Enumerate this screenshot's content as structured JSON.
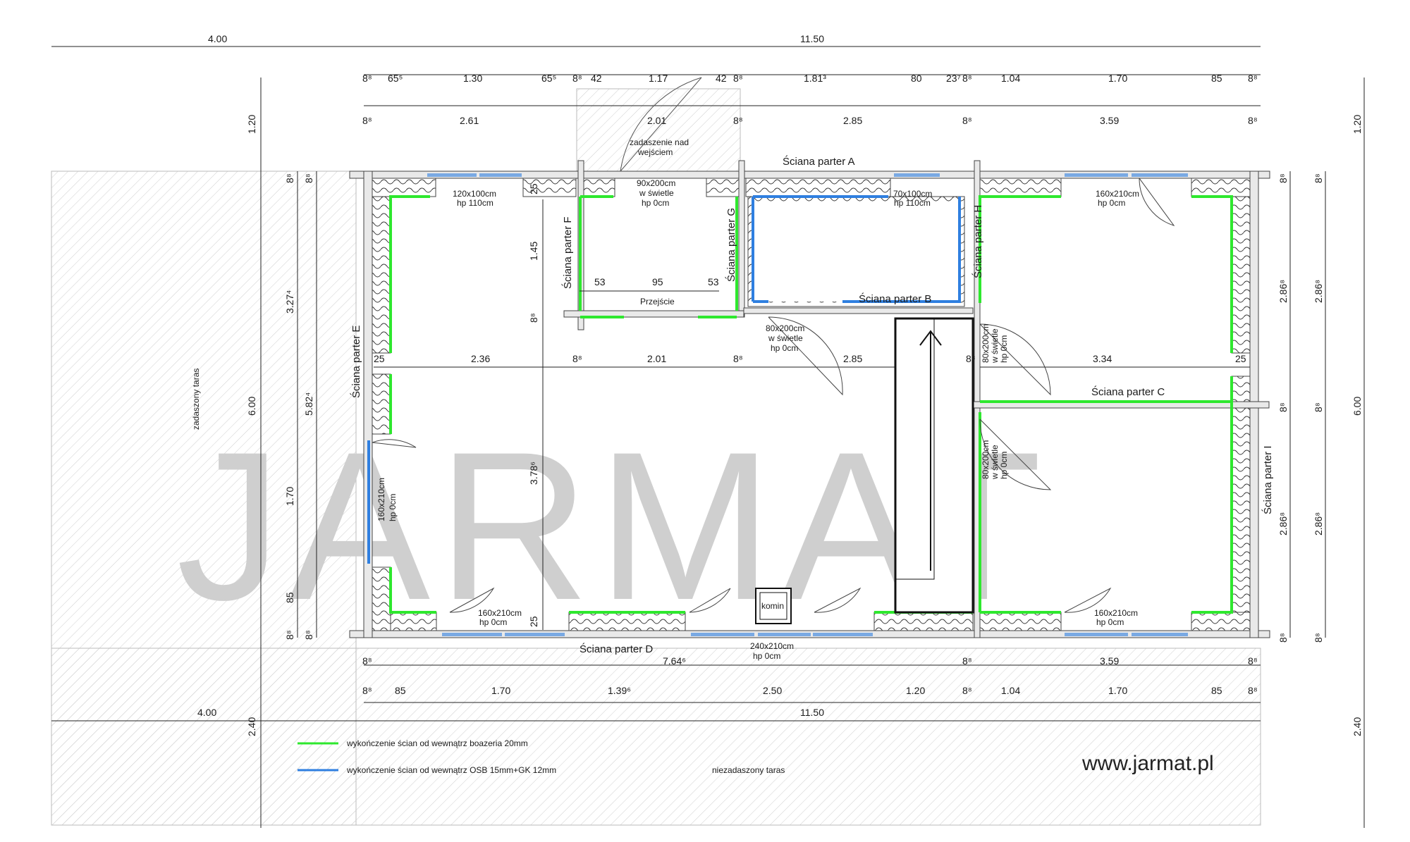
{
  "top_dims": {
    "overall": [
      "4.00",
      "11.50"
    ],
    "row1": [
      "8⁸",
      "65⁵",
      "1.30",
      "65⁵",
      "8⁸",
      "42",
      "1.17",
      "42",
      "8⁸",
      "1.81³",
      "80",
      "23⁷",
      "8⁸",
      "1.04",
      "1.70",
      "85",
      "8⁸"
    ],
    "row2": [
      "8⁸",
      "2.61",
      "2.01",
      "8⁸",
      "2.85",
      "8⁸",
      "3.59",
      "8⁸"
    ]
  },
  "bottom_dims": {
    "row1": [
      "8⁸",
      "7.64⁶",
      "8⁸",
      "3.59",
      "8⁸"
    ],
    "row2": [
      "8⁸",
      "85",
      "1.70",
      "1.39⁶",
      "2.50",
      "1.20",
      "8⁸",
      "1.04",
      "1.70",
      "85",
      "8⁸"
    ],
    "overall": [
      "4.00",
      "11.50"
    ]
  },
  "mid_dims": [
    "25",
    "2.36",
    "8⁸",
    "2.01",
    "8⁸",
    "2.85",
    "8⁸",
    "3.34",
    "25"
  ],
  "left_dims": [
    "1.20",
    "6.00",
    "2.40",
    "3.27⁴",
    "5.82⁴",
    "1.70",
    "85",
    "8⁸",
    "8⁸",
    "8⁸",
    "8⁸"
  ],
  "right_dims": [
    "1.20",
    "6.00",
    "2.40",
    "2.86⁸",
    "2.86⁸",
    "2.86⁸",
    "2.86⁸",
    "8⁸",
    "8⁸",
    "8⁸",
    "8⁸",
    "8⁸",
    "8⁸"
  ],
  "inner_dims": [
    "25",
    "1.45",
    "8⁸",
    "53",
    "95",
    "53",
    "3.78⁶",
    "25"
  ],
  "walls": {
    "a": "Ściana parter A",
    "b": "Ściana parter B",
    "c": "Ściana parter C",
    "d": "Ściana parter D",
    "e": "Ściana parter E",
    "f": "Ściana parter F",
    "g": "Ściana parter G",
    "h": "Ściana parter H",
    "i": "Ściana parter I"
  },
  "openings": {
    "w1": [
      "120x100cm",
      "hp 110cm"
    ],
    "entry": [
      "90x200cm",
      "w świetle",
      "hp 0cm"
    ],
    "w2": [
      "70x100cm",
      "hp 110cm"
    ],
    "d1": [
      "160x210cm",
      "hp 0cm"
    ],
    "inner_door": [
      "80x200cm",
      "w świetle",
      "hp 0cm"
    ],
    "right_door_upper": [
      "80x200cm",
      "w świetle",
      "hp 0cm"
    ],
    "right_door_lower": [
      "80x200cm",
      "w świetle",
      "hp 0cm"
    ],
    "left_door": [
      "160x210cm",
      "hp 0cm"
    ],
    "bottom_left": [
      "160x210cm",
      "hp 0cm"
    ],
    "bottom_mid": [
      "240x210cm",
      "hp 0cm"
    ],
    "bottom_right": [
      "160x210cm",
      "hp 0cm"
    ]
  },
  "labels": {
    "canopy": [
      "zadaszenie nad",
      "wejściem"
    ],
    "passage": "Przejście",
    "chimney": "komin",
    "covered_terrace": "zadaszony taras",
    "open_terrace": "niezadaszony taras"
  },
  "legend": {
    "green_text": "wykończenie ścian od wewnątrz boazeria 20mm",
    "blue_text": "wykończenie ścian od wewnątrz OSB 15mm+GK 12mm",
    "green_color": "#2ee82e",
    "blue_color": "#2f7fe0"
  },
  "watermark": "JARMAT",
  "url": "www.jarmat.pl"
}
